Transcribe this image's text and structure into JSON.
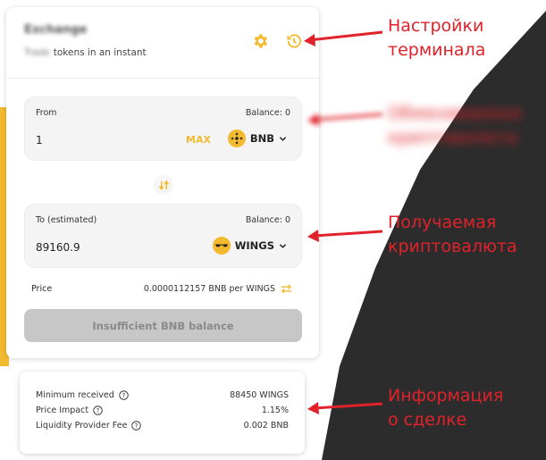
{
  "header": {
    "title": "Exchange",
    "subtitle_blurred": "Trade",
    "subtitle": "tokens in an instant",
    "icons": [
      "gear-icon",
      "history-icon"
    ]
  },
  "from": {
    "label": "From",
    "balance": "Balance: 0",
    "amount": "1",
    "max_label": "MAX",
    "token": "BNB",
    "token_icon": "bnb-icon"
  },
  "to": {
    "label": "To (estimated)",
    "balance": "Balance: 0",
    "amount": "89160.9",
    "token": "WINGS",
    "token_icon": "wings-icon"
  },
  "price": {
    "label": "Price",
    "value": "0.0000112157 BNB per WINGS"
  },
  "submit": {
    "label": "Insufficient BNB balance"
  },
  "details": [
    {
      "label": "Minimum received",
      "value": "88450 WINGS"
    },
    {
      "label": "Price Impact",
      "value": "1.15%"
    },
    {
      "label": "Liquidity Provider Fee",
      "value": "0.002 BNB"
    }
  ],
  "annotations": {
    "terminal_settings": [
      "Настройки",
      "терминала"
    ],
    "exchanged_crypto_blurred": [
      "Обмениваемая",
      "криптовалюта"
    ],
    "received_crypto": [
      "Получаемая",
      "криптовалюта"
    ],
    "deal_info": [
      "Информация",
      "о сделке"
    ]
  },
  "colors": {
    "accent": "#f3ba2f",
    "annotation": "#e1222a",
    "dark_bg": "#2c2c2c"
  }
}
